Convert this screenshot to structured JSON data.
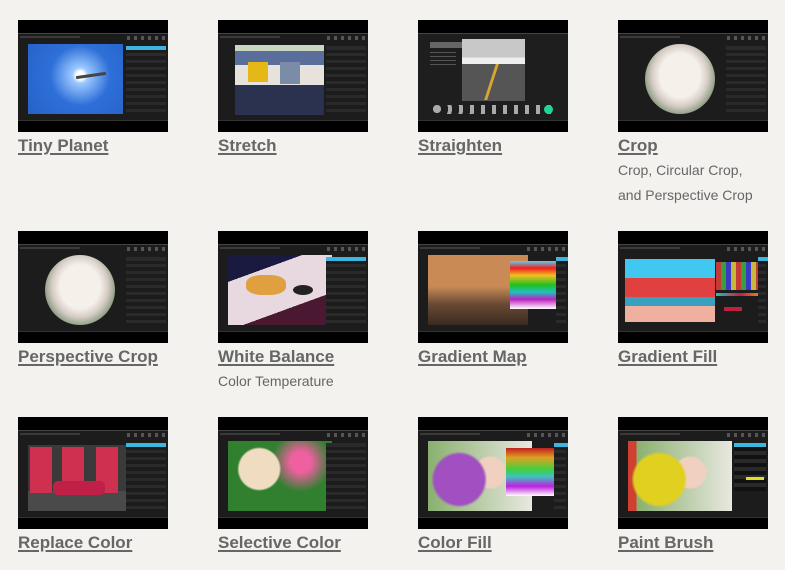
{
  "tools": [
    {
      "title": "Tiny Planet",
      "subtitle": null,
      "thumbnail": "tiny-planet-editor-screenshot"
    },
    {
      "title": "Stretch",
      "subtitle": null,
      "thumbnail": "stretch-editor-screenshot"
    },
    {
      "title": "Straighten",
      "subtitle": null,
      "thumbnail": "straighten-editor-screenshot"
    },
    {
      "title": "Crop",
      "subtitle_lines": [
        "Crop, Circular Crop,",
        "and Perspective Crop"
      ],
      "thumbnail": "crop-editor-screenshot"
    },
    {
      "title": "Perspective Crop",
      "subtitle": null,
      "thumbnail": "perspective-crop-editor-screenshot"
    },
    {
      "title": "White Balance",
      "subtitle_lines": [
        "Color Temperature"
      ],
      "thumbnail": "white-balance-editor-screenshot"
    },
    {
      "title": "Gradient Map",
      "subtitle": null,
      "thumbnail": "gradient-map-editor-screenshot"
    },
    {
      "title": "Gradient Fill",
      "subtitle": null,
      "thumbnail": "gradient-fill-editor-screenshot"
    },
    {
      "title": "Replace Color",
      "subtitle": null,
      "thumbnail": "replace-color-editor-screenshot"
    },
    {
      "title": "Selective Color",
      "subtitle": null,
      "thumbnail": "selective-color-editor-screenshot"
    },
    {
      "title": "Color Fill",
      "subtitle": null,
      "thumbnail": "color-fill-editor-screenshot"
    },
    {
      "title": "Paint Brush",
      "subtitle": null,
      "thumbnail": "paint-brush-editor-screenshot"
    }
  ],
  "colors": {
    "background": "#f3f2ef",
    "link_text": "#666666",
    "panel_accent": "#3ab6e0"
  }
}
